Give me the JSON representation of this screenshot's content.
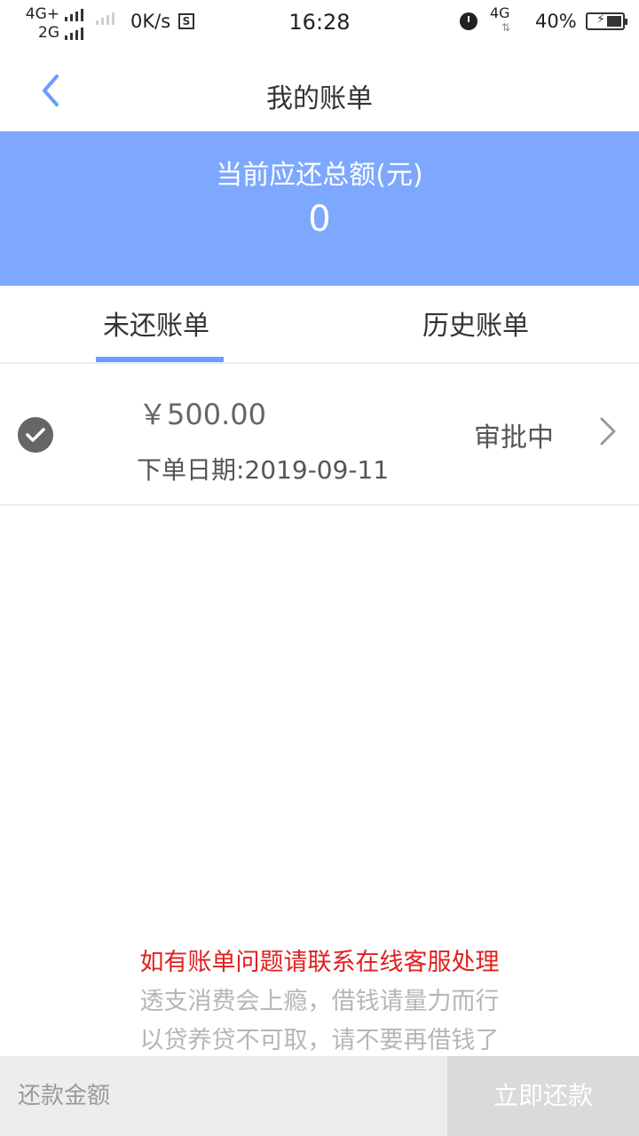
{
  "status_bar": {
    "network_primary": "4G+",
    "network_secondary": "2G",
    "speed": "0K/s",
    "speed_badge": "S",
    "time": "16:28",
    "network_right": "4G",
    "battery_percent": "40%"
  },
  "header": {
    "title": "我的账单"
  },
  "summary": {
    "label": "当前应还总额(元)",
    "amount": "0"
  },
  "tabs": [
    {
      "label": "未还账单",
      "active": true
    },
    {
      "label": "历史账单",
      "active": false
    }
  ],
  "bills": [
    {
      "amount": "￥500.00",
      "date": "下单日期:2019-09-11",
      "status": "审批中"
    }
  ],
  "notices": {
    "red": "如有账单问题请联系在线客服处理",
    "gray1": "透支消费会上瘾，借钱请量力而行",
    "gray2": "以贷养贷不可取，请不要再借钱了"
  },
  "bottom": {
    "amount_placeholder": "还款金额",
    "pay_label": "立即还款"
  },
  "colors": {
    "banner": "#7ea7ff",
    "tab_indicator": "#6b9cff",
    "notice_red": "#e02020"
  }
}
